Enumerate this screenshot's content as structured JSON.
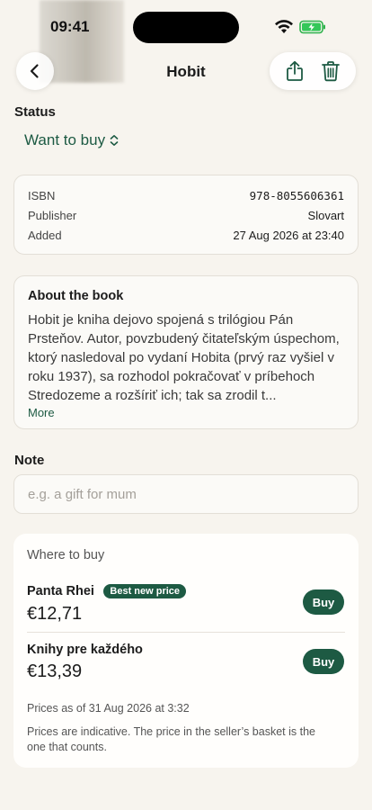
{
  "status_bar": {
    "time": "09:41"
  },
  "nav": {
    "title": "Hobit"
  },
  "status": {
    "label": "Status",
    "value": "Want to buy"
  },
  "meta": [
    {
      "key": "ISBN",
      "value": "978-8055606361"
    },
    {
      "key": "Publisher",
      "value": "Slovart"
    },
    {
      "key": "Added",
      "value": "27 Aug 2026 at 23:40"
    }
  ],
  "about": {
    "title": "About the book",
    "text": "Hobit je kniha dejovo spojená s trilógiou Pán Prsteňov. Autor, povzbudený čitateľským úspechom, ktorý nasledoval po vydaní Hobita (prvý raz vyšiel v roku 1937), sa rozhodol pokračovať v príbehoch Stredozeme a rozšíriť ich; tak sa zrodil t...",
    "more": "More"
  },
  "note": {
    "label": "Note",
    "placeholder": "e.g. a gift for mum",
    "value": ""
  },
  "where_to_buy": {
    "title": "Where to buy",
    "sellers": [
      {
        "name": "Panta Rhei",
        "badge": "Best new price",
        "price": "€12,71",
        "button": "Buy"
      },
      {
        "name": "Knihy pre každého",
        "badge": "",
        "price": "€13,39",
        "button": "Buy"
      }
    ],
    "prices_as_of": "Prices as of 31 Aug 2026 at 3:32",
    "disclaimer": "Prices are indicative. The price in the seller’s basket is the one that counts."
  },
  "colors": {
    "accent": "#1d5a43",
    "background": "#f7f4ee",
    "card": "#fbfaf7"
  }
}
